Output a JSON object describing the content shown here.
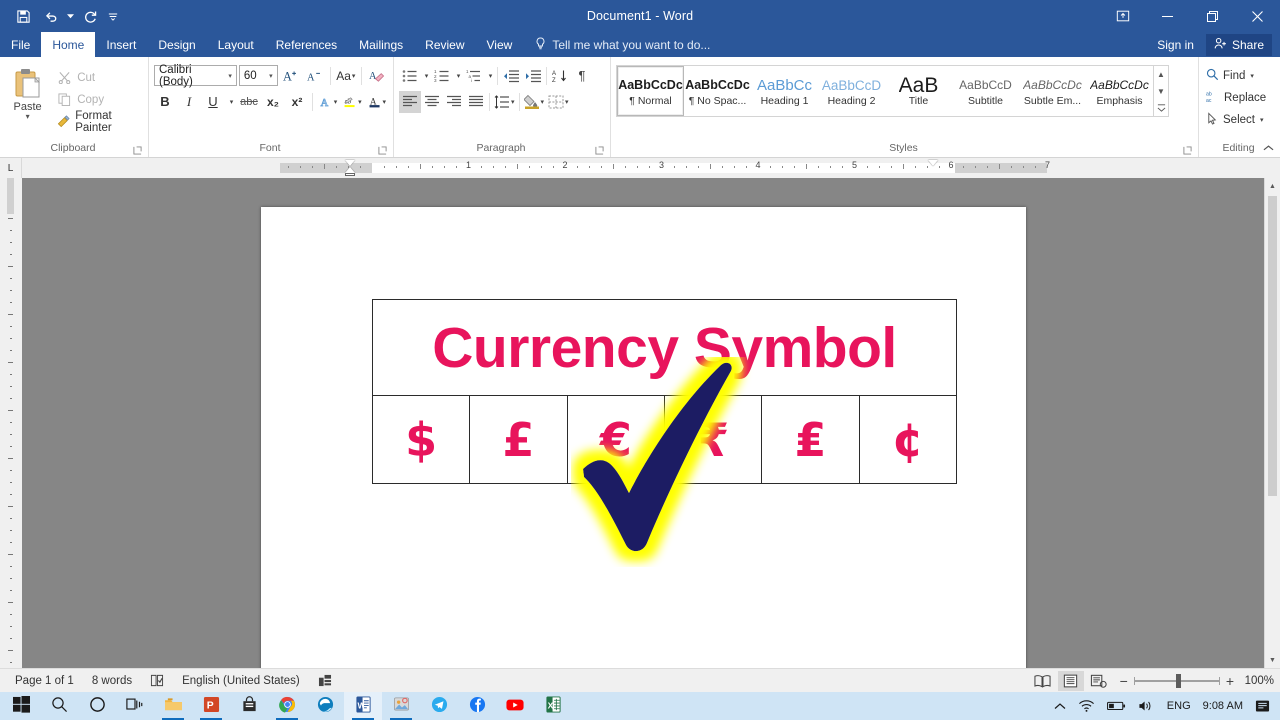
{
  "titlebar": {
    "document_title": "Document1 - Word",
    "qat": [
      {
        "name": "save",
        "icon": "save-icon",
        "label": "Save"
      },
      {
        "name": "undo",
        "icon": "undo-icon",
        "label": "Undo"
      },
      {
        "name": "redo",
        "icon": "redo-icon",
        "label": "Repeat"
      },
      {
        "name": "customize-qat",
        "icon": "chevron-down-icon",
        "label": "Customize Quick Access Toolbar"
      }
    ],
    "ribbon_display_options": "Ribbon Display Options",
    "minimize": "Minimize",
    "restore": "Restore Down",
    "close": "Close"
  },
  "tabs": [
    {
      "label": "File",
      "active": false,
      "file": true
    },
    {
      "label": "Home",
      "active": true
    },
    {
      "label": "Insert",
      "active": false
    },
    {
      "label": "Design",
      "active": false
    },
    {
      "label": "Layout",
      "active": false
    },
    {
      "label": "References",
      "active": false
    },
    {
      "label": "Mailings",
      "active": false
    },
    {
      "label": "Review",
      "active": false
    },
    {
      "label": "View",
      "active": false
    }
  ],
  "tell_me": {
    "placeholder": "Tell me what you want to do..."
  },
  "account": {
    "sign_in": "Sign in",
    "share": "Share"
  },
  "ribbon": {
    "clipboard": {
      "group_label": "Clipboard",
      "paste_label": "Paste",
      "cut_label": "Cut",
      "copy_label": "Copy",
      "format_painter_label": "Format Painter"
    },
    "font": {
      "group_label": "Font",
      "font_name": "Calibri (Body)",
      "font_size": "60",
      "grow_font": "Increase Font Size",
      "shrink_font": "Decrease Font Size",
      "change_case": "Aa",
      "clear_formatting": "Clear All Formatting",
      "bold": "B",
      "italic": "I",
      "underline": "U",
      "strikethrough": "abc",
      "subscript": "x₂",
      "superscript": "x²",
      "text_effects": "A",
      "highlight": "ab",
      "font_color": "A"
    },
    "paragraph": {
      "group_label": "Paragraph",
      "bullets": "Bullets",
      "numbering": "Numbering",
      "multilevel": "Multilevel List",
      "decrease_indent": "Decrease Indent",
      "increase_indent": "Increase Indent",
      "sort": "Sort",
      "show_marks": "¶",
      "align_left": "Align Left",
      "align_center": "Center",
      "align_right": "Align Right",
      "justify": "Justify",
      "line_spacing": "Line and Paragraph Spacing",
      "shading": "Shading",
      "borders": "Borders"
    },
    "styles": {
      "group_label": "Styles",
      "items": [
        {
          "preview": "AaBbCcDc",
          "name": "¶ Normal",
          "selected": true
        },
        {
          "preview": "AaBbCcDc",
          "name": "¶ No Spac...",
          "selected": false
        },
        {
          "preview": "AaBbCc",
          "name": "Heading 1",
          "selected": false
        },
        {
          "preview": "AaBbCcD",
          "name": "Heading 2",
          "selected": false
        },
        {
          "preview": "AaB",
          "name": "Title",
          "selected": false
        },
        {
          "preview": "AaBbCcD",
          "name": "Subtitle",
          "selected": false
        },
        {
          "preview": "AaBbCcDc",
          "name": "Subtle Em...",
          "selected": false
        },
        {
          "preview": "AaBbCcDc",
          "name": "Emphasis",
          "selected": false
        }
      ]
    },
    "editing": {
      "group_label": "Editing",
      "find_label": "Find",
      "replace_label": "Replace",
      "select_label": "Select"
    }
  },
  "ruler": {
    "h_numbers": [
      "1",
      "1",
      "2",
      "3",
      "4",
      "5",
      "6",
      "7"
    ],
    "tab_stop_marker": "L"
  },
  "document": {
    "table": {
      "title_row": "Currency Symbol",
      "symbol_row": [
        "$",
        "£",
        "€",
        "₹",
        "₤",
        "¢"
      ]
    },
    "annotation": {
      "name": "check-mark",
      "fill": "#1b1b64",
      "glow": "#ffff00"
    },
    "text_color": "#e8145c"
  },
  "statusbar": {
    "page": "Page 1 of 1",
    "words": "8 words",
    "proofing": "Proofing errors",
    "language": "English (United States)",
    "accessibility": "Accessibility",
    "views": [
      {
        "name": "read-mode",
        "label": "Read Mode",
        "active": false
      },
      {
        "name": "print-layout",
        "label": "Print Layout",
        "active": true
      },
      {
        "name": "web-layout",
        "label": "Web Layout",
        "active": false
      }
    ],
    "zoom_out": "−",
    "zoom_in": "+",
    "zoom_level": "100%"
  },
  "taskbar": {
    "buttons": [
      {
        "name": "start-button",
        "icon": "windows-logo-icon",
        "running": false
      },
      {
        "name": "search-button",
        "icon": "search-icon",
        "running": false
      },
      {
        "name": "cortana-button",
        "icon": "cortana-circle-icon",
        "running": false
      },
      {
        "name": "task-view-button",
        "icon": "task-view-icon",
        "running": false
      },
      {
        "name": "file-explorer-button",
        "icon": "folder-icon",
        "running": true
      },
      {
        "name": "powerpoint-button",
        "icon": "powerpoint-icon",
        "running": true
      },
      {
        "name": "microsoft-store-button",
        "icon": "store-bag-icon",
        "running": false
      },
      {
        "name": "chrome-button",
        "icon": "chrome-icon",
        "running": true
      },
      {
        "name": "edge-button",
        "icon": "edge-icon",
        "running": false
      },
      {
        "name": "word-button",
        "icon": "word-icon",
        "running": true
      },
      {
        "name": "photos-button",
        "icon": "photos-icon",
        "running": true
      },
      {
        "name": "telegram-button",
        "icon": "telegram-icon",
        "running": false
      },
      {
        "name": "facebook-button",
        "icon": "facebook-icon",
        "running": false
      },
      {
        "name": "youtube-button",
        "icon": "youtube-icon",
        "running": false
      },
      {
        "name": "excel-button",
        "icon": "excel-icon",
        "running": false
      }
    ],
    "tray": {
      "show_hidden": "^",
      "network": "wifi-icon",
      "battery": "battery-icon",
      "volume": "speaker-icon",
      "language": "ENG",
      "time": "9:08 AM",
      "notifications": "notification-icon"
    }
  }
}
